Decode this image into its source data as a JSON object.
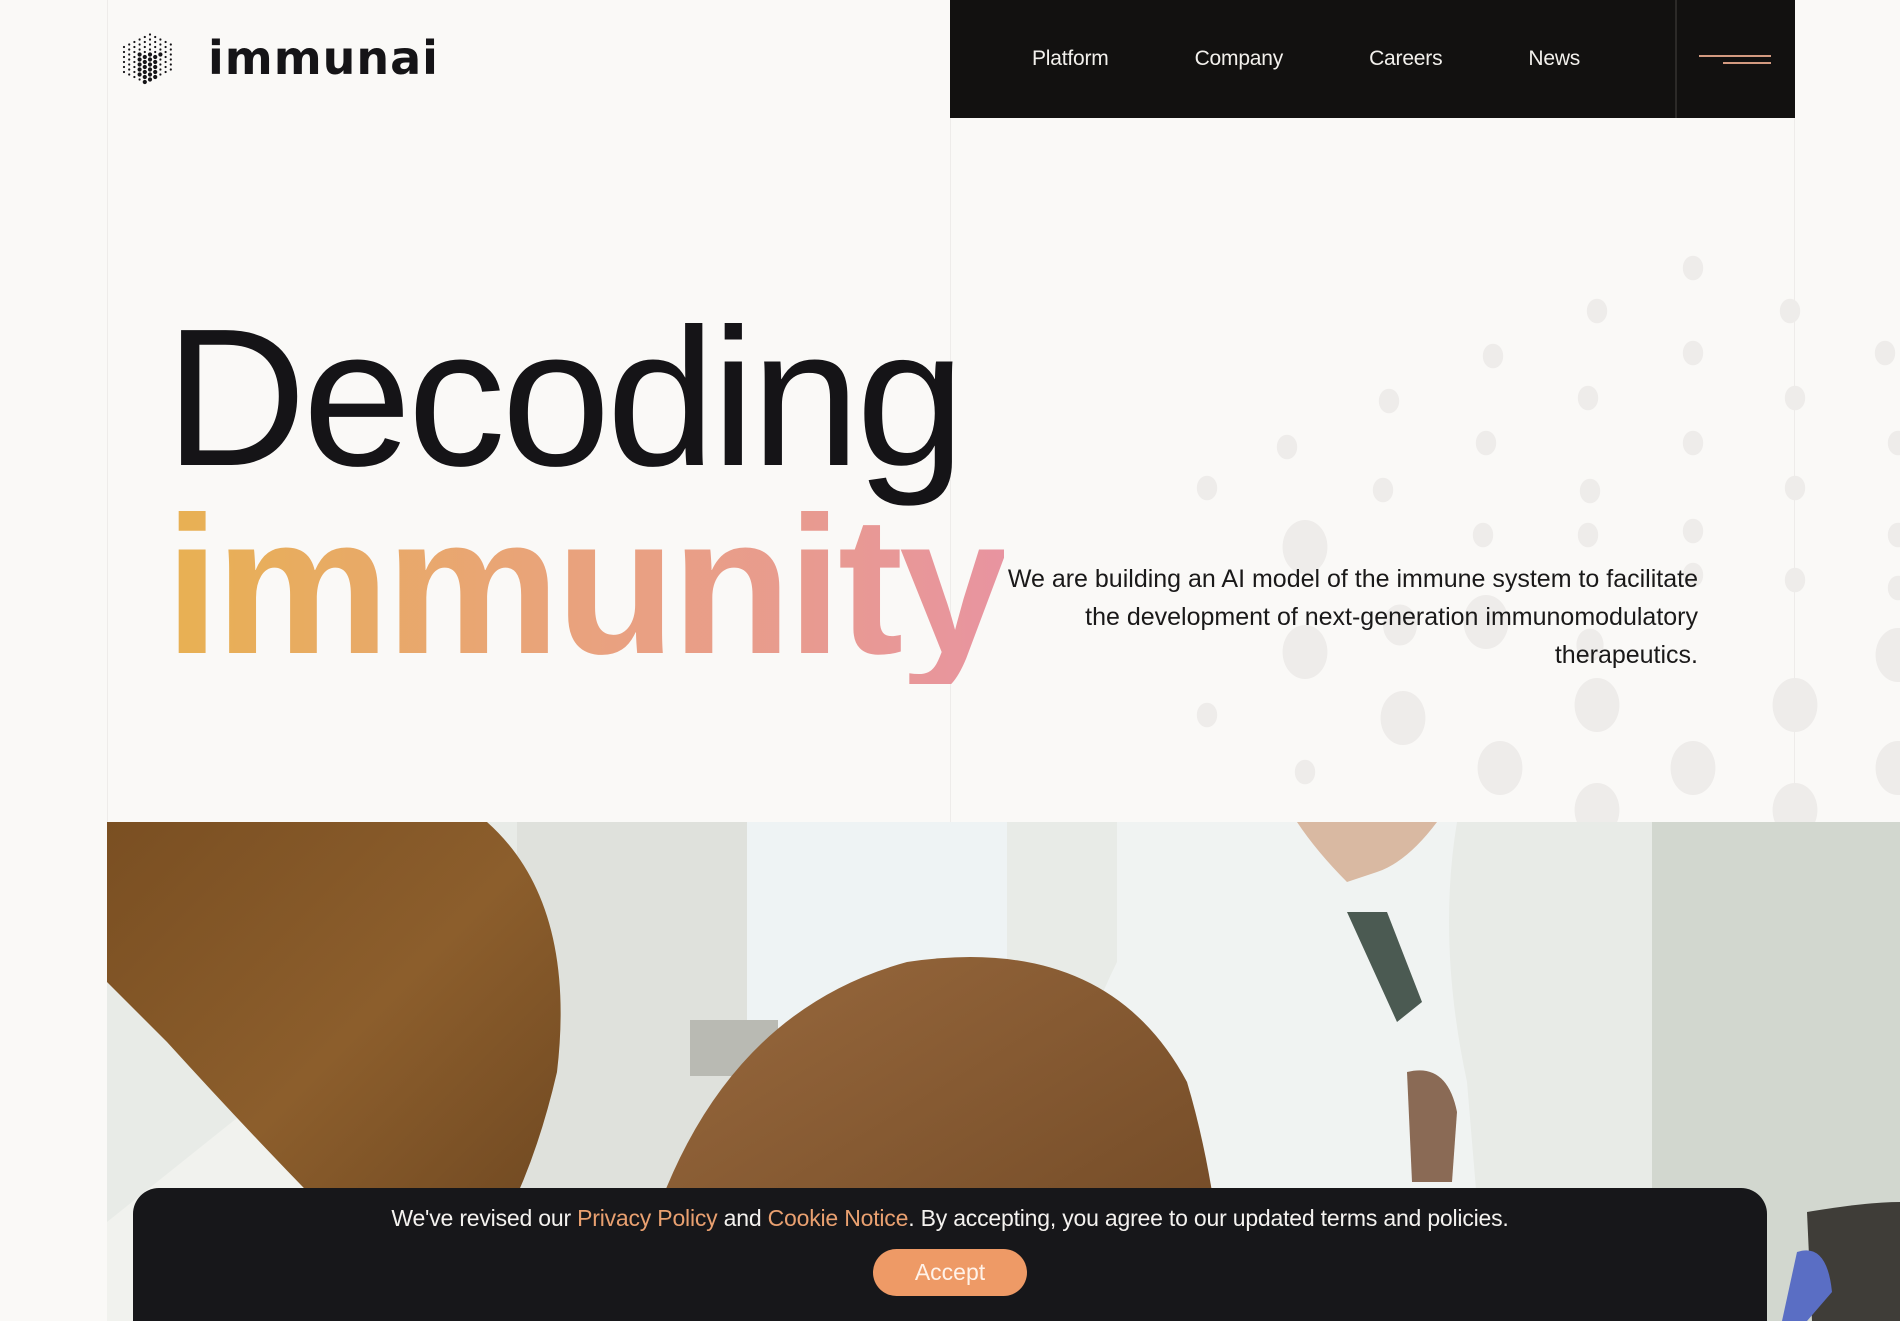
{
  "brand": {
    "name": "immunai",
    "logo_icon": "dotted-cube-icon"
  },
  "nav": {
    "items": [
      {
        "label": "Platform"
      },
      {
        "label": "Company"
      },
      {
        "label": "Careers"
      },
      {
        "label": "News"
      }
    ],
    "menu_icon": "hamburger-menu-icon",
    "accent_color": "#d39a80",
    "background_color": "#121110"
  },
  "hero": {
    "headline_line1": "Decoding",
    "headline_line2": "immunity",
    "headline_gradient": [
      "#e8b152",
      "#e9a27e",
      "#e894a0"
    ],
    "tagline": "We are building an AI model of the immune system to facilitate the development of next-generation immunomodulatory therapeutics.",
    "media_description": "Lab scientists in white coats"
  },
  "cookie_banner": {
    "text_before": "We've revised our ",
    "privacy_link": "Privacy Policy",
    "text_middle": " and ",
    "cookie_link": "Cookie Notice",
    "text_after": ". By accepting, you agree to our updated terms and policies.",
    "accept_label": "Accept",
    "accent_color": "#ee9a66"
  }
}
